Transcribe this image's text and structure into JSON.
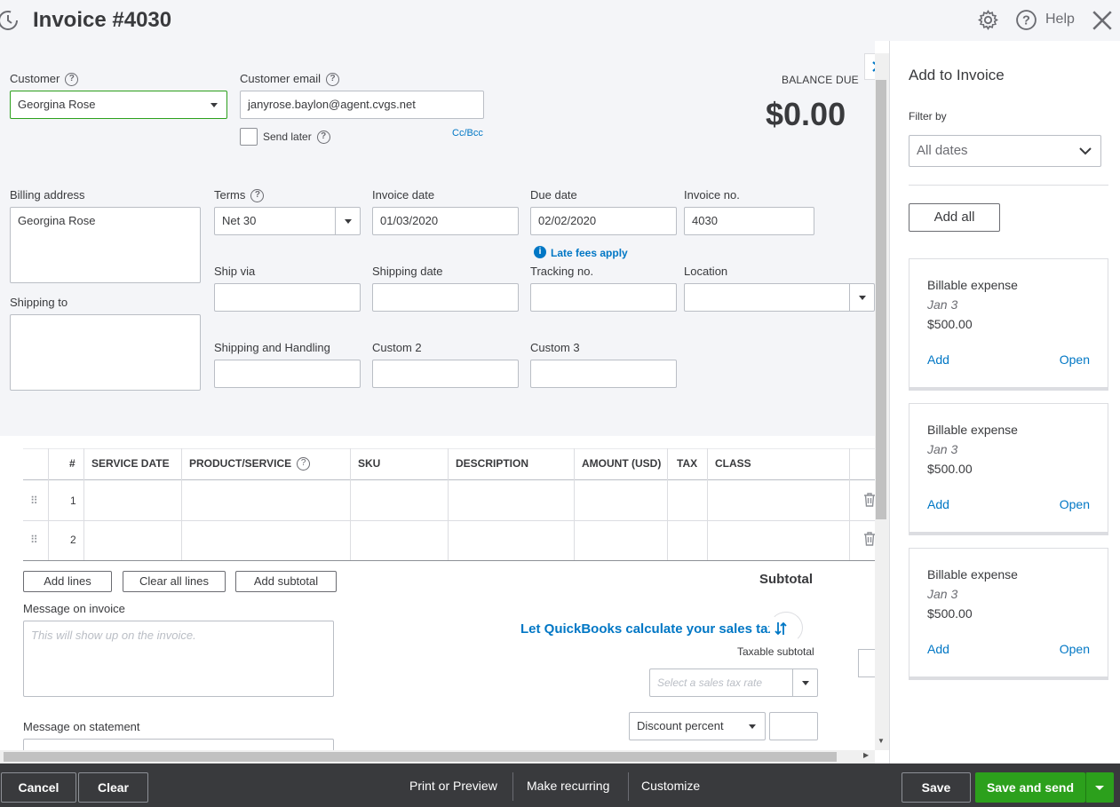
{
  "header": {
    "title": "Invoice #4030",
    "help_label": "Help",
    "icons": [
      "history-icon",
      "gear-icon",
      "help-icon",
      "close-icon"
    ]
  },
  "customer": {
    "label": "Customer",
    "value": "Georgina Rose",
    "email_label": "Customer email",
    "email_value": "janyrose.baylon@agent.cvgs.net",
    "send_later_label": "Send later",
    "ccbcc_label": "Cc/Bcc"
  },
  "balance": {
    "label": "BALANCE DUE",
    "value": "$0.00"
  },
  "billing": {
    "billing_label": "Billing address",
    "billing_value": "Georgina Rose",
    "shipping_label": "Shipping to",
    "terms_label": "Terms",
    "terms_value": "Net 30",
    "invoice_date_label": "Invoice date",
    "invoice_date_value": "01/03/2020",
    "due_date_label": "Due date",
    "due_date_value": "02/02/2020",
    "invoice_no_label": "Invoice no.",
    "invoice_no_value": "4030",
    "late_fees_label": "Late fees apply",
    "ship_via_label": "Ship via",
    "shipping_date_label": "Shipping date",
    "tracking_label": "Tracking no.",
    "location_label": "Location",
    "shipping_handling_label": "Shipping and Handling",
    "custom2_label": "Custom 2",
    "custom3_label": "Custom 3"
  },
  "table": {
    "columns": [
      "#",
      "SERVICE DATE",
      "PRODUCT/SERVICE",
      "SKU",
      "DESCRIPTION",
      "AMOUNT (USD)",
      "TAX",
      "CLASS"
    ],
    "rows": [
      {
        "num": "1"
      },
      {
        "num": "2"
      }
    ],
    "add_lines_label": "Add lines",
    "clear_lines_label": "Clear all lines",
    "add_subtotal_label": "Add subtotal",
    "subtotal_label": "Subtotal"
  },
  "messages": {
    "invoice_label": "Message on invoice",
    "invoice_placeholder": "This will show up on the invoice.",
    "statement_label": "Message on statement"
  },
  "tax": {
    "calc_link": "Let QuickBooks calculate your sales tax",
    "taxable_label": "Taxable subtotal",
    "rate_placeholder": "Select a sales tax rate",
    "discount_label": "Discount percent"
  },
  "panel": {
    "title": "Add to Invoice",
    "filter_label": "Filter by",
    "filter_value": "All dates",
    "add_all_label": "Add all",
    "cards": [
      {
        "title": "Billable expense",
        "date": "Jan 3",
        "amount": "$500.00",
        "add": "Add",
        "open": "Open"
      },
      {
        "title": "Billable expense",
        "date": "Jan 3",
        "amount": "$500.00",
        "add": "Add",
        "open": "Open"
      },
      {
        "title": "Billable expense",
        "date": "Jan 3",
        "amount": "$500.00",
        "add": "Add",
        "open": "Open"
      }
    ]
  },
  "footer": {
    "cancel": "Cancel",
    "clear": "Clear",
    "print": "Print or Preview",
    "recurring": "Make recurring",
    "customize": "Customize",
    "save": "Save",
    "save_send": "Save and send"
  },
  "colors": {
    "accent_green": "#2ca01c",
    "link_blue": "#0077c5",
    "footer_bg": "#393a3d"
  }
}
